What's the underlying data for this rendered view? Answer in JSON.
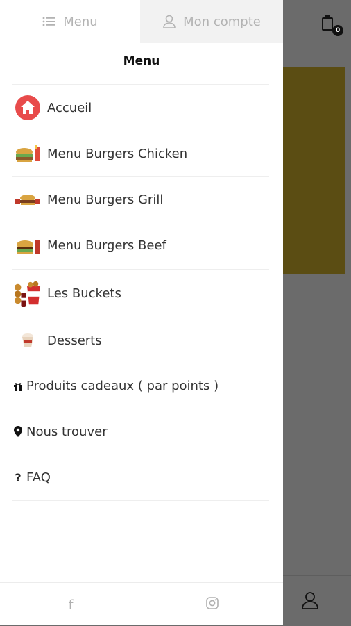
{
  "tabs": {
    "menu_label": "Menu",
    "account_label": "Mon compte"
  },
  "drawer": {
    "title": "Menu"
  },
  "menu": {
    "items": [
      {
        "label": "Accueil",
        "icon": "home-icon"
      },
      {
        "label": "Menu Burgers Chicken",
        "icon": "burger-chicken-image"
      },
      {
        "label": "Menu Burgers Grill",
        "icon": "burger-grill-image"
      },
      {
        "label": "Menu Burgers Beef",
        "icon": "burger-beef-image"
      },
      {
        "label": "Les Buckets",
        "icon": "bucket-image"
      },
      {
        "label": "Desserts",
        "icon": "dessert-image"
      },
      {
        "label": "Produits cadeaux ( par points )",
        "icon": "gift-icon"
      },
      {
        "label": "Nous trouver",
        "icon": "map-marker-icon"
      },
      {
        "label": "FAQ",
        "icon": "question-icon"
      }
    ]
  },
  "cart": {
    "count": "0"
  },
  "footer": {
    "facebook_glyph": "f"
  },
  "colors": {
    "accent_red": "#e84b4b",
    "overlay": "#6b6b6b",
    "banner": "#5b4d13",
    "muted_text": "#b3b3b3"
  }
}
